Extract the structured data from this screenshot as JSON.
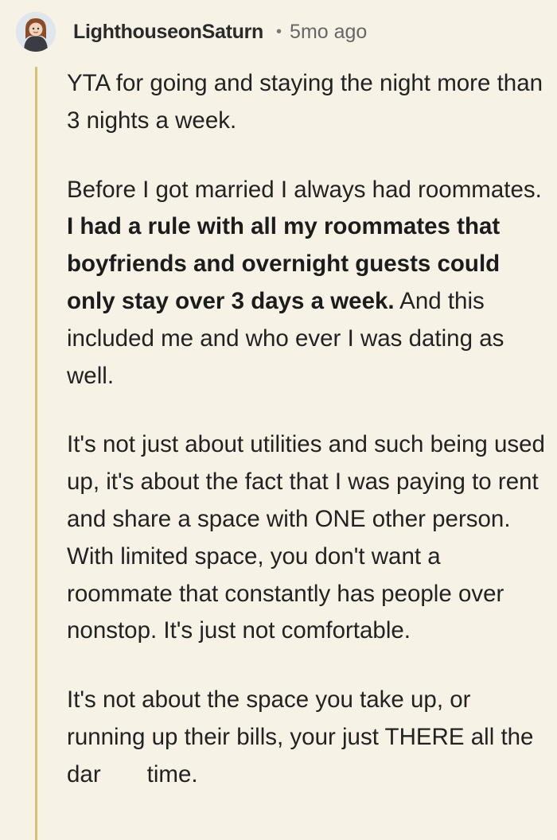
{
  "comment": {
    "author": "LighthouseonSaturn",
    "separator": "•",
    "time_ago": "5mo ago",
    "avatar_icon": "user-avatar",
    "thread_line_color": "#d7c46a",
    "paragraphs": {
      "p1": "YTA for going and staying the night more than 3 nights a week.",
      "p2_before": "Before I got married I always had roommates. ",
      "p2_bold": "I had a rule with all my roommates that boyfriends and overnight guests could only stay over 3 days a week.",
      "p2_after": " And this included me and who ever I was dating as well.",
      "p3": "It's not just about utilities and such being used up, it's about the fact that I was paying to rent and share a space with ONE other person. With limited space, you don't want a roommate that constantly has people over nonstop. It's just not comfortable.",
      "p4_start": "It's not about the space you take up, or running up their bills, your just THERE all the dar",
      "p4_end": "time."
    }
  }
}
